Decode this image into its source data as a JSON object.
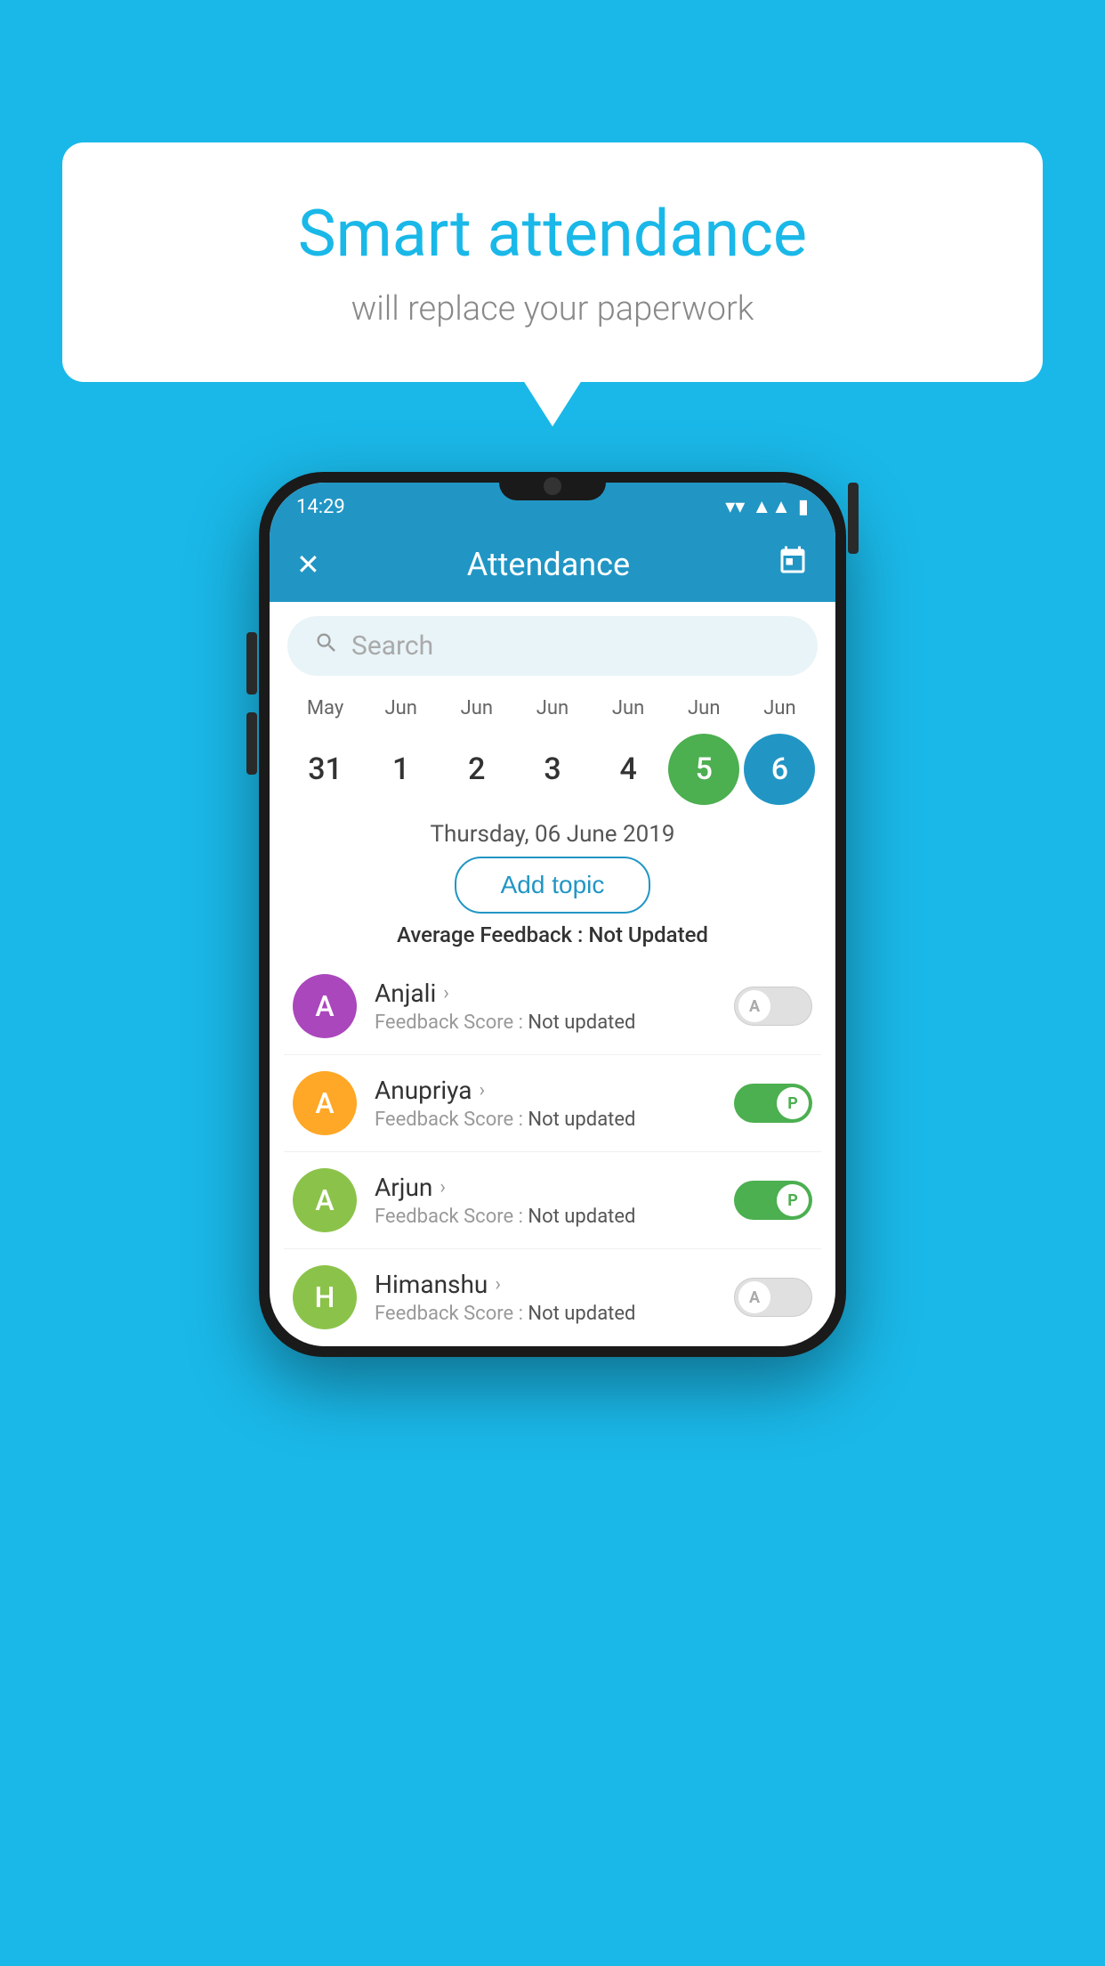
{
  "background_color": "#1ab8e8",
  "hero": {
    "title": "Smart attendance",
    "subtitle": "will replace your paperwork"
  },
  "status_bar": {
    "time": "14:29",
    "wifi": "▼",
    "signal": "▲",
    "battery": "▮"
  },
  "app_bar": {
    "close_label": "✕",
    "title": "Attendance",
    "calendar_icon": "📅"
  },
  "search": {
    "placeholder": "Search"
  },
  "calendar": {
    "months": [
      "May",
      "Jun",
      "Jun",
      "Jun",
      "Jun",
      "Jun",
      "Jun"
    ],
    "days": [
      "31",
      "1",
      "2",
      "3",
      "4",
      "5",
      "6"
    ],
    "today_index": 5,
    "selected_index": 6
  },
  "selected_date": "Thursday, 06 June 2019",
  "add_topic_label": "Add topic",
  "avg_feedback": {
    "label": "Average Feedback :",
    "value": "Not Updated"
  },
  "students": [
    {
      "name": "Anjali",
      "avatar_letter": "A",
      "avatar_color": "#ab47bc",
      "feedback_label": "Feedback Score :",
      "feedback_value": "Not updated",
      "toggle_state": "off",
      "toggle_letter": "A"
    },
    {
      "name": "Anupriya",
      "avatar_letter": "A",
      "avatar_color": "#ffa726",
      "feedback_label": "Feedback Score :",
      "feedback_value": "Not updated",
      "toggle_state": "on",
      "toggle_letter": "P"
    },
    {
      "name": "Arjun",
      "avatar_letter": "A",
      "avatar_color": "#8bc34a",
      "feedback_label": "Feedback Score :",
      "feedback_value": "Not updated",
      "toggle_state": "on",
      "toggle_letter": "P"
    },
    {
      "name": "Himanshu",
      "avatar_letter": "H",
      "avatar_color": "#8bc34a",
      "feedback_label": "Feedback Score :",
      "feedback_value": "Not updated",
      "toggle_state": "off",
      "toggle_letter": "A"
    }
  ]
}
